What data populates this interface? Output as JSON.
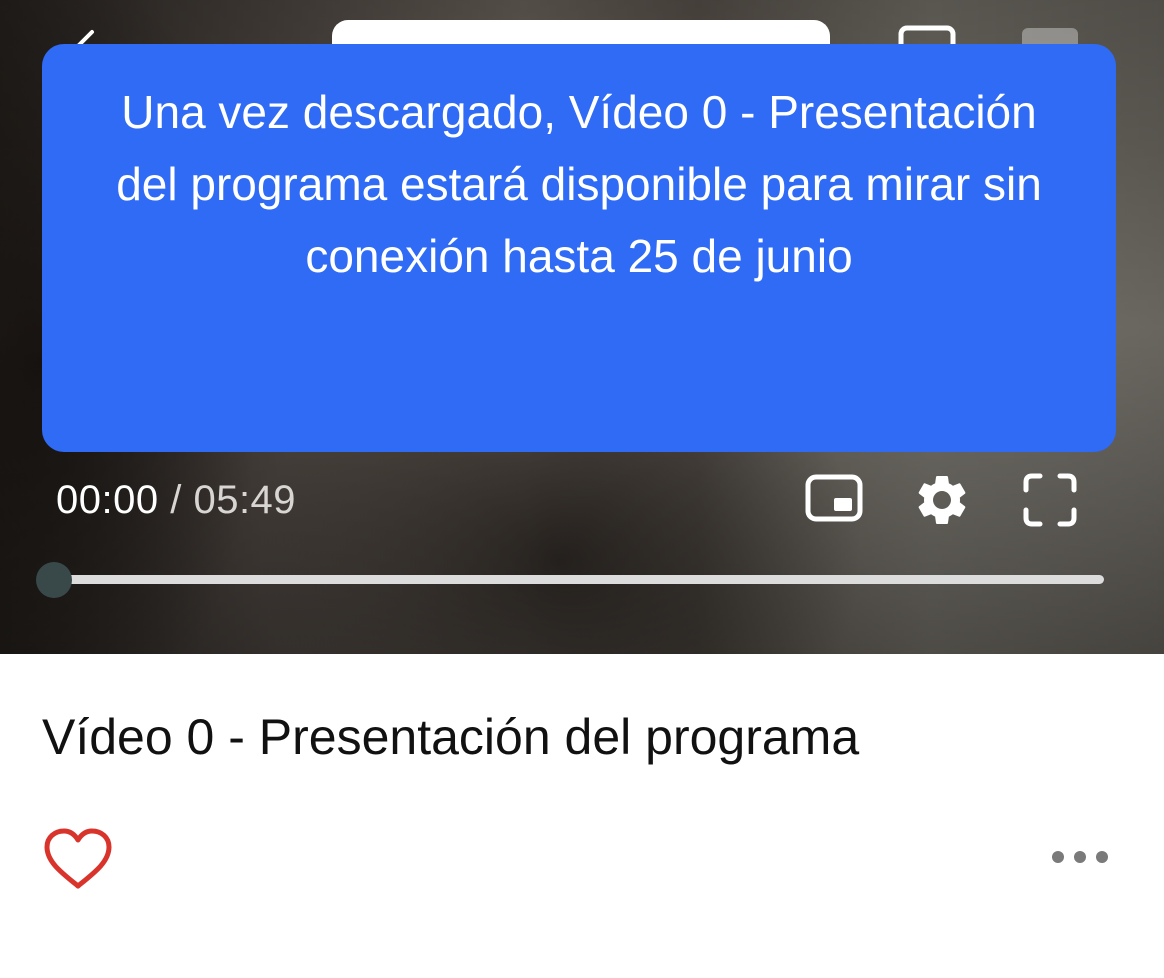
{
  "player": {
    "current_time": "00:00",
    "time_separator": " / ",
    "duration": "05:49",
    "progress_fraction": 0
  },
  "toast": {
    "message": "Una vez descargado, Vídeo 0 - Presentación del programa estará disponible para mirar sin conexión hasta 25 de junio"
  },
  "video": {
    "title": "Vídeo 0 - Presentación del programa"
  },
  "icons": {
    "back": "chevron-left-icon",
    "cast": "cast-icon",
    "pip": "picture-in-picture-icon",
    "settings": "gear-icon",
    "fullscreen": "fullscreen-icon",
    "like": "heart-icon",
    "more": "more-horizontal-icon"
  },
  "colors": {
    "toast_background": "#2f6bf5",
    "heart": "#d9342b",
    "progress_thumb": "#39494a",
    "progress_track": "#dcdcdc"
  }
}
